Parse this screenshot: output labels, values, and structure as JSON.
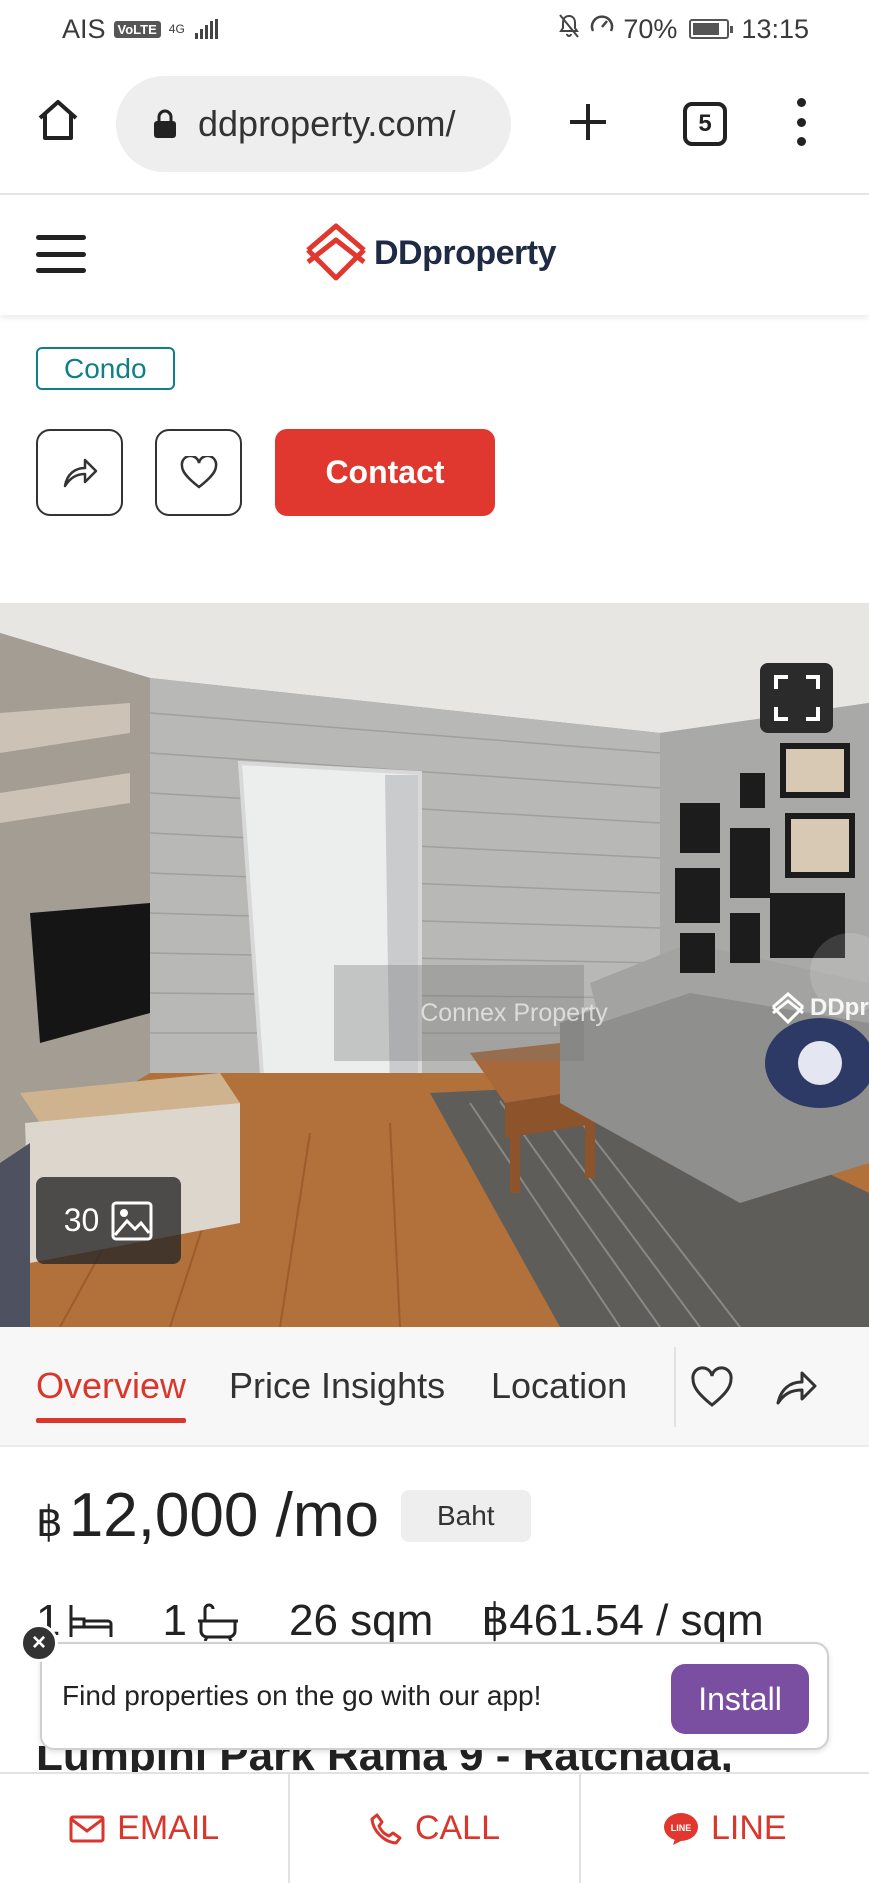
{
  "status_bar": {
    "carrier": "AIS",
    "volte": "VoLTE",
    "network": "4G",
    "battery": "70%",
    "time": "13:15"
  },
  "browser": {
    "url": "ddproperty.com/",
    "tab_count": "5"
  },
  "site": {
    "brand": "DDproperty"
  },
  "listing": {
    "tag": "Condo",
    "contact_label": "Contact",
    "photo_count": "30",
    "watermark_text": "Connex Property",
    "watermark_brand": "DDpr"
  },
  "tabs": [
    {
      "label": "Overview",
      "active": true
    },
    {
      "label": "Price Insights",
      "active": false
    },
    {
      "label": "Location",
      "active": false
    }
  ],
  "price": {
    "currency": "฿",
    "amount": "12,000 /mo",
    "unit_chip": "Baht"
  },
  "specs": {
    "beds": "1",
    "baths": "1",
    "area": "26 sqm",
    "price_per_sqm": "฿461.54 / sqm"
  },
  "app_banner": {
    "text": "Find properties on the go with our app!",
    "install_label": "Install"
  },
  "title_partial": "Lumpini Park Rama 9 - Ratchada,",
  "bottom_bar": {
    "email": "EMAIL",
    "call": "CALL",
    "line": "LINE"
  },
  "colors": {
    "brand_red": "#e0372e",
    "teal": "#0f7f8a",
    "install_purple": "#7a4ea0"
  }
}
